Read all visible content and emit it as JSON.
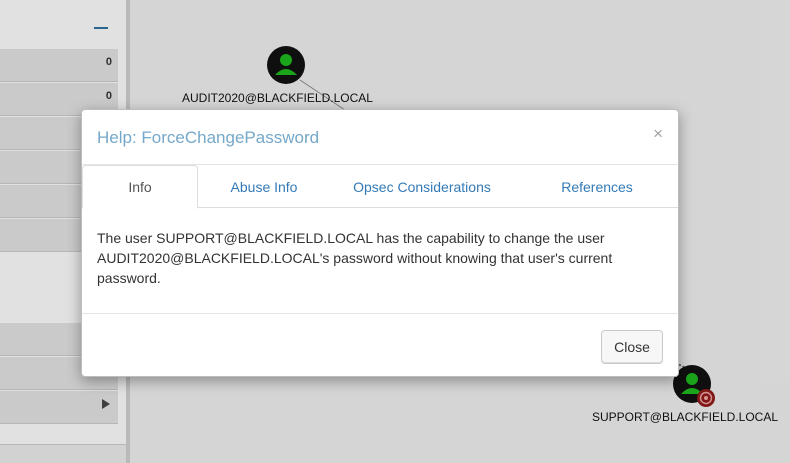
{
  "left_panel": {
    "rows": [
      {
        "count": "0"
      },
      {
        "count": "0"
      },
      {
        "count": ""
      },
      {
        "count": ""
      },
      {
        "count": ""
      },
      {
        "count": ""
      }
    ]
  },
  "graph": {
    "nodes": [
      {
        "label": "AUDIT2020@BLACKFIELD.LOCAL",
        "icon": "user-icon"
      },
      {
        "label": "SUPPORT@BLACKFIELD.LOCAL",
        "icon": "owned-user-icon"
      }
    ]
  },
  "modal": {
    "title": "Help: ForceChangePassword",
    "close_symbol": "×",
    "tabs": [
      "Info",
      "Abuse Info",
      "Opsec Considerations",
      "References"
    ],
    "active_tab": "Info",
    "body_text": "The user SUPPORT@BLACKFIELD.LOCAL has the capability to change the user AUDIT2020@BLACKFIELD.LOCAL's password without knowing that user's current password.",
    "close_button": "Close"
  },
  "colors": {
    "title": "#75a8c9",
    "link": "#337ab7",
    "node_green": "#1e9e1e",
    "target_red": "#c0392b"
  }
}
